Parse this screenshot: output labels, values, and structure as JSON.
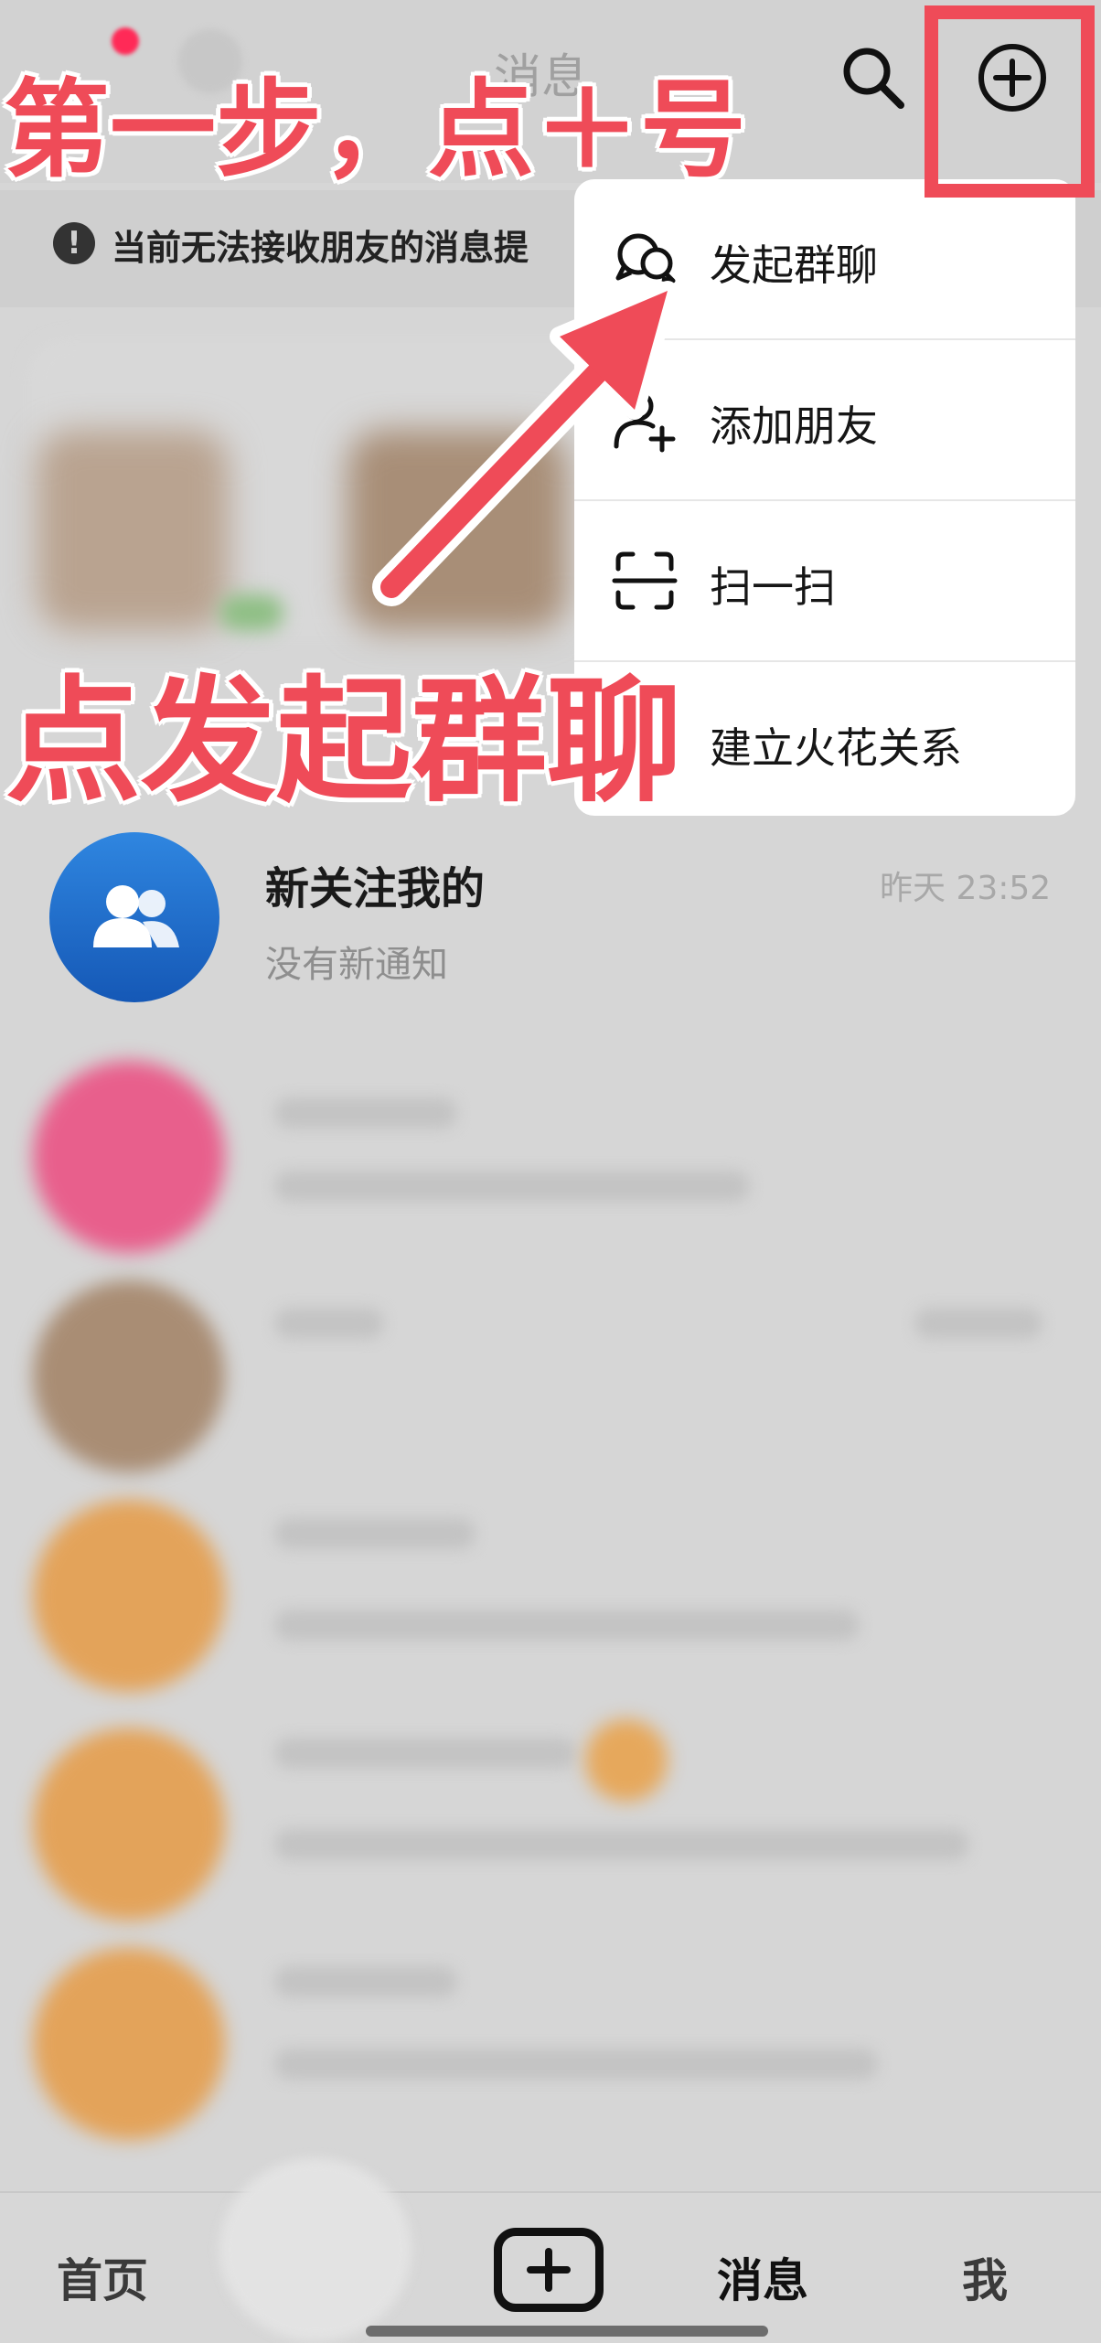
{
  "header": {
    "title": "消息",
    "search_icon": "search-icon",
    "add_icon": "plus-circle-icon"
  },
  "warning": {
    "text": "当前无法接收朋友的消息提",
    "icon": "alert-icon"
  },
  "menu": {
    "items": [
      {
        "label": "发起群聊",
        "icon": "group-chat-icon"
      },
      {
        "label": "添加朋友",
        "icon": "add-friend-icon"
      },
      {
        "label": "扫一扫",
        "icon": "scan-icon"
      },
      {
        "label": "建立火花关系",
        "icon": "spark-icon"
      }
    ]
  },
  "follow_notice": {
    "title": "新关注我的",
    "subtitle": "没有新通知",
    "time": "昨天 23:52",
    "icon": "people-icon",
    "accent": "#1f6fd1"
  },
  "annotations": {
    "step1": "第一步，点＋号",
    "step2": "点发起群聊",
    "color": "#ef4b58"
  },
  "bottom_nav": {
    "home": "首页",
    "create_icon": "plus-square-icon",
    "messages": "消息",
    "me": "我"
  }
}
